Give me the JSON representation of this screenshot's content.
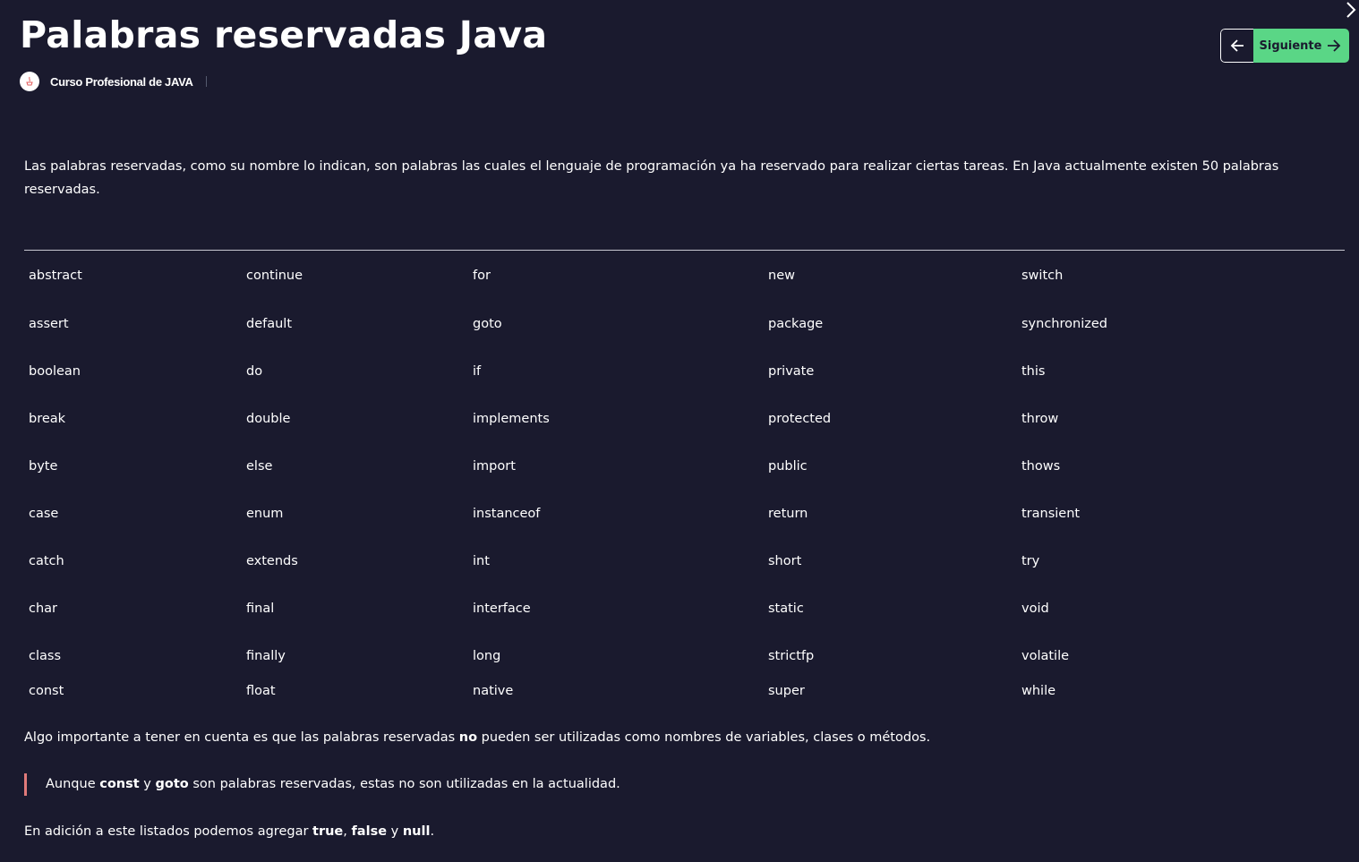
{
  "header": {
    "title": "Palabras reservadas Java",
    "course_name": "Curso Profesional de JAVA",
    "prev_icon": "arrow-left-icon",
    "next_label": "Siguiente",
    "next_icon": "arrow-right-icon",
    "corner_icon": "chevron-right-icon"
  },
  "colors": {
    "background": "#1a1a2e",
    "accent_green": "#5ad686",
    "quote_bar": "#e07a7a"
  },
  "intro": "Las palabras reservadas, como su nombre lo indican, son palabras las cuales el lenguaje de programación ya ha reservado para realizar ciertas tareas. En Java actualmente existen 50 palabras reservadas.",
  "keywords_table": {
    "rows": [
      [
        "abstract",
        "continue",
        "for",
        "new",
        "switch"
      ],
      [
        "assert",
        "default",
        "goto",
        "package",
        "synchronized"
      ],
      [
        "boolean",
        "do",
        "if",
        "private",
        "this"
      ],
      [
        "break",
        "double",
        "implements",
        "protected",
        "throw"
      ],
      [
        "byte",
        "else",
        "import",
        "public",
        "thows"
      ],
      [
        "case",
        "enum",
        "instanceof",
        "return",
        "transient"
      ],
      [
        "catch",
        "extends",
        "int",
        "short",
        "try"
      ],
      [
        "char",
        "final",
        "interface",
        "static",
        "void"
      ],
      [
        "class",
        "finally",
        "long",
        "strictfp",
        "volatile"
      ],
      [
        "const",
        "float",
        "native",
        "super",
        "while"
      ]
    ]
  },
  "note": {
    "before": "Algo importante a tener en cuenta es que las palabras reservadas ",
    "bold": "no",
    "after": " pueden ser utilizadas como nombres de variables, clases o métodos."
  },
  "quote": {
    "before": "Aunque ",
    "bold1": "const",
    "mid": " y ",
    "bold2": "goto",
    "after": " son palabras reservadas, estas no son utilizadas en la actualidad."
  },
  "closing": {
    "before": "En adición a este listados podemos agregar ",
    "bold1": "true",
    "sep1": ", ",
    "bold2": "false",
    "sep2": " y ",
    "bold3": "null",
    "after": "."
  }
}
